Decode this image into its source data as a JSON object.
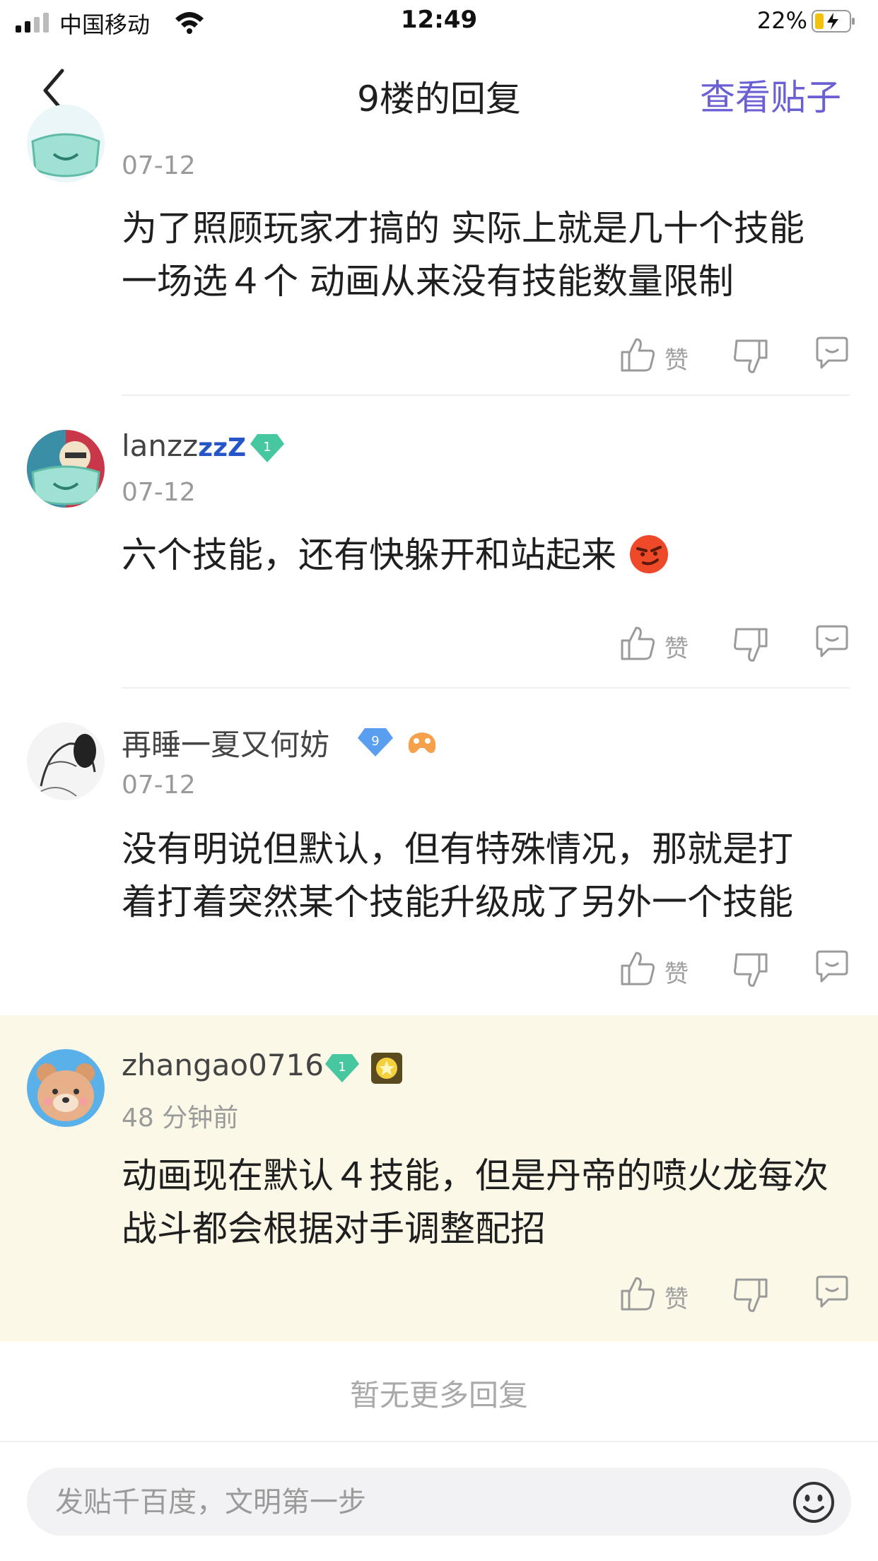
{
  "status_bar": {
    "carrier": "中国移动",
    "time": "12:49",
    "battery_percent": "22%"
  },
  "nav": {
    "back_icon": "chevron-left-icon",
    "title": "9楼的回复",
    "view_post_label": "查看贴子"
  },
  "colors": {
    "accent": "#6a5fd3",
    "highlight_bg": "#fbf8e7",
    "level_green": "#46c7a0",
    "level_blue": "#5a9ef0"
  },
  "replies": [
    {
      "username": "",
      "date": "07-12",
      "text_line1": "为了照顾玩家才搞的 实际上就是几十个技能",
      "text_line2": "一场选４个 动画从来没有技能数量限制",
      "like_label": "赞"
    },
    {
      "username": "lanzz",
      "username_suffix": "zzZ",
      "level": "1",
      "date": "07-12",
      "text_line1": "六个技能，还有快躲开和站起来",
      "like_label": "赞"
    },
    {
      "username": "再睡一夏又何妨",
      "level": "9",
      "date": "07-12",
      "text_line1": "没有明说但默认，但有特殊情况，那就是打",
      "text_line2": "着打着突然某个技能升级成了另外一个技能",
      "like_label": "赞"
    },
    {
      "username": "zhangao0716",
      "level": "1",
      "date": "48 分钟前",
      "text_line1": "动画现在默认４技能，但是丹帝的喷火龙每次",
      "text_line2": "战斗都会根据对手调整配招",
      "like_label": "赞"
    }
  ],
  "no_more_text": "暂无更多回复",
  "compose": {
    "placeholder": "发贴千百度，文明第一步",
    "emoji_icon": "smiley-icon"
  }
}
